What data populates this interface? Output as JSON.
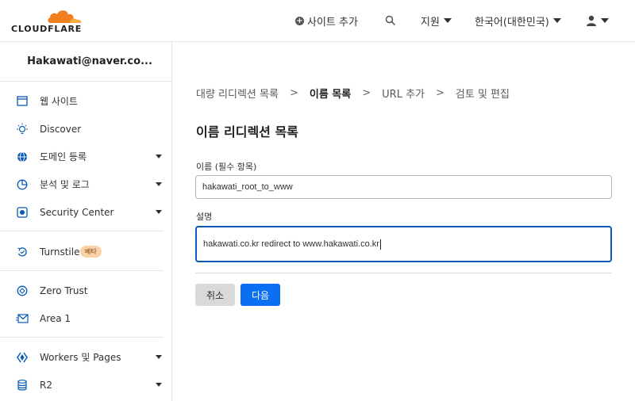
{
  "header": {
    "logo_text": "CLOUDFLARE",
    "add_site_label": "사이트 추가",
    "support_label": "지원",
    "language_label": "한국어(대한민국)"
  },
  "sidebar": {
    "account_name": "Hakawati@naver.co...",
    "items": [
      {
        "label": "웹 사이트",
        "icon": "browser-window-icon"
      },
      {
        "label": "Discover",
        "icon": "lightbulb-icon"
      },
      {
        "label": "도메인 등록",
        "icon": "globe-icon"
      },
      {
        "label": "분석 및 로그",
        "icon": "pie-chart-icon"
      },
      {
        "label": "Security Center",
        "icon": "security-center-icon"
      },
      {
        "label": "Turnstile",
        "icon": "turnstile-icon",
        "badge": "베타"
      },
      {
        "label": "Zero Trust",
        "icon": "zero-trust-icon"
      },
      {
        "label": "Area 1",
        "icon": "envelope-icon"
      },
      {
        "label": "Workers 및 Pages",
        "icon": "workers-icon"
      },
      {
        "label": "R2",
        "icon": "database-icon"
      }
    ]
  },
  "breadcrumb": {
    "items": [
      "대량 리디렉션 목록",
      "이름 목록",
      "URL 추가",
      "검토 및 편집"
    ]
  },
  "form": {
    "title": "이름 리디렉션 목록",
    "name_label": "이름 (필수 항목)",
    "name_value": "hakawati_root_to_www",
    "description_label": "설명",
    "description_value": "hakawati.co.kr redirect to www.hakawati.co.kr",
    "cancel_label": "취소",
    "next_label": "다음"
  },
  "colors": {
    "accent": "#0a6ff0",
    "logo_orange": "#f38020",
    "badge_bg": "#fbd2a8"
  }
}
